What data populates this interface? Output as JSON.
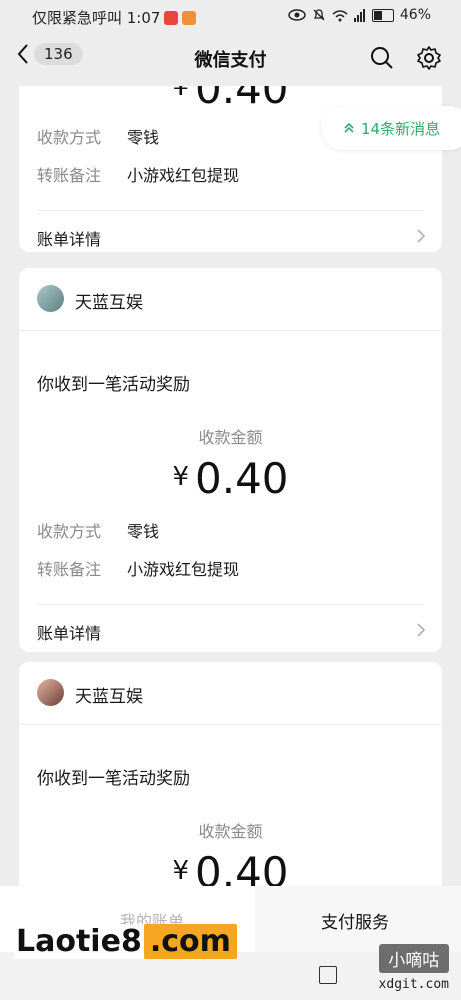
{
  "status_bar": {
    "left_text": "仅限紧急呼叫 1:07",
    "battery": "46%"
  },
  "nav": {
    "back_badge": "136",
    "title": "微信支付"
  },
  "new_messages": "14条新消息",
  "partial_card": {
    "amount": "0.40",
    "rows": [
      {
        "key": "收款方式",
        "value": "零钱"
      },
      {
        "key": "转账备注",
        "value": "小游戏红包提现"
      }
    ],
    "detail_label": "账单详情"
  },
  "cards": [
    {
      "sender": "天蓝互娱",
      "headline": "你收到一笔活动奖励",
      "amount_label": "收款金额",
      "currency": "¥",
      "amount": "0.40",
      "rows": [
        {
          "key": "收款方式",
          "value": "零钱"
        },
        {
          "key": "转账备注",
          "value": "小游戏红包提现"
        }
      ],
      "detail_label": "账单详情"
    },
    {
      "sender": "天蓝互娱",
      "headline": "你收到一笔活动奖励",
      "amount_label": "收款金额",
      "currency": "¥",
      "amount": "0.40"
    }
  ],
  "bottom": {
    "my_bills": "我的账单",
    "pay_services": "支付服务"
  },
  "watermarks": {
    "left_1": "Laotie8",
    "left_2": ".com",
    "right_box": "小嘀咕",
    "right_url": "xdgit.com"
  },
  "colors": {
    "accent_green": "#2aae67",
    "background": "#ededed",
    "watermark_orange": "#f5a623"
  }
}
